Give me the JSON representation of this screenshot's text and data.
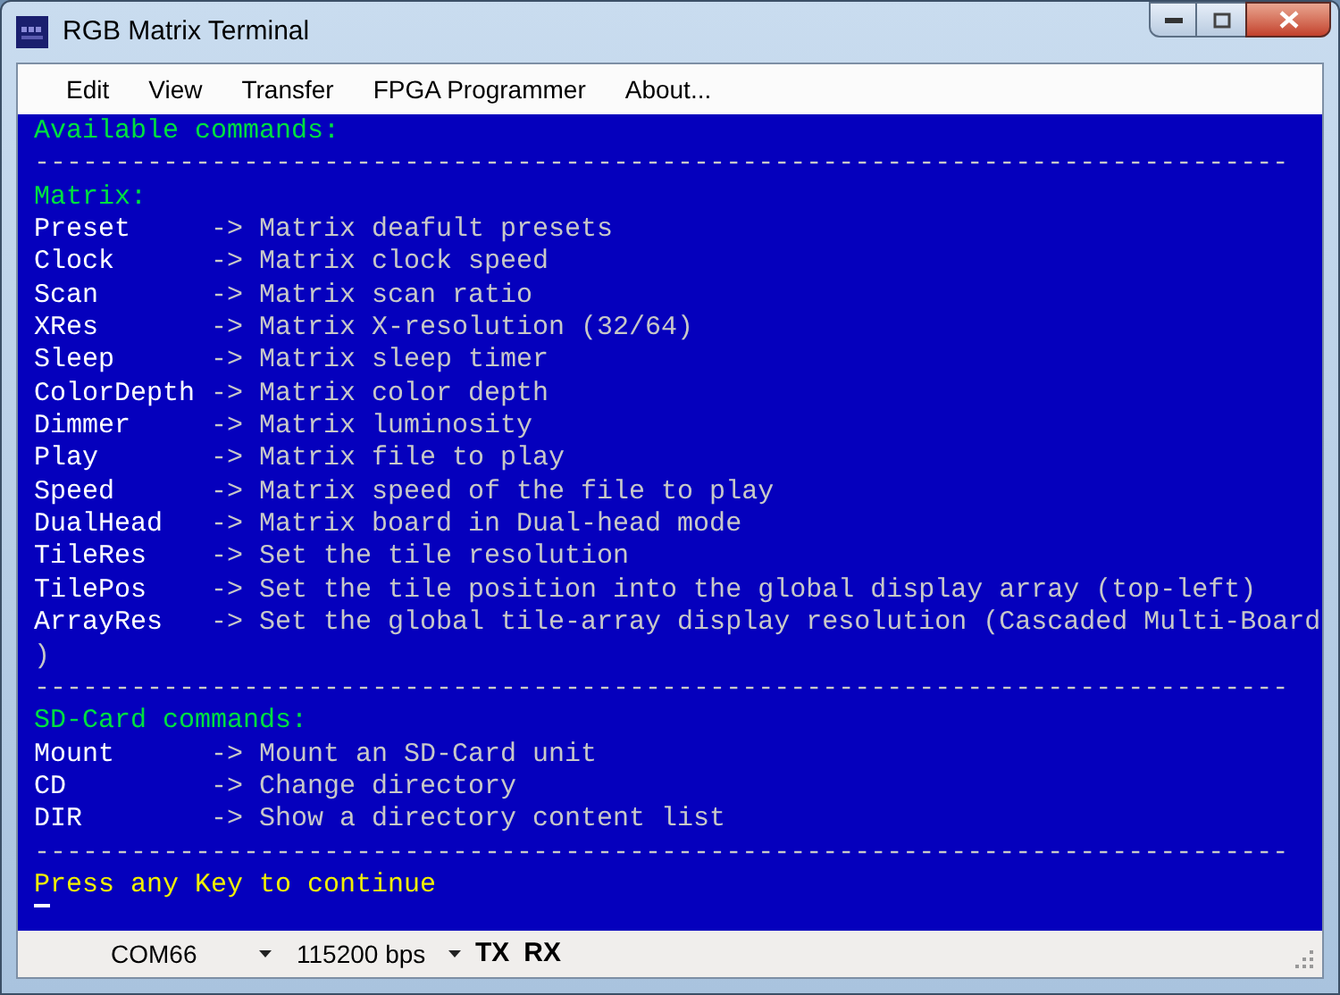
{
  "window": {
    "title": "RGB Matrix Terminal"
  },
  "menu": [
    "Edit",
    "View",
    "Transfer",
    "FPGA Programmer",
    "About..."
  ],
  "terminal": {
    "lines": [
      {
        "kind": "heading",
        "text": "Available commands:"
      },
      {
        "kind": "rule",
        "text": "------------------------------------------------------------------------------"
      },
      {
        "kind": "heading",
        "text": "Matrix:"
      },
      {
        "kind": "command",
        "command": "Preset",
        "description": "-> Matrix deafult presets"
      },
      {
        "kind": "command",
        "command": "Clock",
        "description": "-> Matrix clock speed"
      },
      {
        "kind": "command",
        "command": "Scan",
        "description": "-> Matrix scan ratio"
      },
      {
        "kind": "command",
        "command": "XRes",
        "description": "-> Matrix X-resolution (32/64)"
      },
      {
        "kind": "command",
        "command": "Sleep",
        "description": "-> Matrix sleep timer"
      },
      {
        "kind": "command",
        "command": "ColorDepth",
        "description": "-> Matrix color depth"
      },
      {
        "kind": "command",
        "command": "Dimmer",
        "description": "-> Matrix luminosity"
      },
      {
        "kind": "command",
        "command": "Play",
        "description": "-> Matrix file to play"
      },
      {
        "kind": "command",
        "command": "Speed",
        "description": "-> Matrix speed of the file to play"
      },
      {
        "kind": "command",
        "command": "DualHead",
        "description": "-> Matrix board in Dual-head mode"
      },
      {
        "kind": "command",
        "command": "TileRes",
        "description": "-> Set the tile resolution"
      },
      {
        "kind": "command",
        "command": "TilePos",
        "description": "-> Set the tile position into the global display array (top-left)"
      },
      {
        "kind": "command",
        "command": "ArrayRes",
        "description": "-> Set the global tile-array display resolution (Cascaded Multi-Board"
      },
      {
        "kind": "text",
        "text": ")"
      },
      {
        "kind": "rule",
        "text": "------------------------------------------------------------------------------"
      },
      {
        "kind": "heading",
        "text": "SD-Card commands:"
      },
      {
        "kind": "command",
        "command": "Mount",
        "description": "-> Mount an SD-Card unit"
      },
      {
        "kind": "command",
        "command": "CD",
        "description": "-> Change directory"
      },
      {
        "kind": "command",
        "command": "DIR",
        "description": "-> Show a directory content list"
      },
      {
        "kind": "rule",
        "text": "------------------------------------------------------------------------------"
      },
      {
        "kind": "prompt",
        "text": "Press any Key to continue"
      },
      {
        "kind": "cursor"
      }
    ]
  },
  "status_bar": {
    "port": "COM66",
    "baud": "115200 bps",
    "tx": "TX",
    "rx": "RX"
  }
}
